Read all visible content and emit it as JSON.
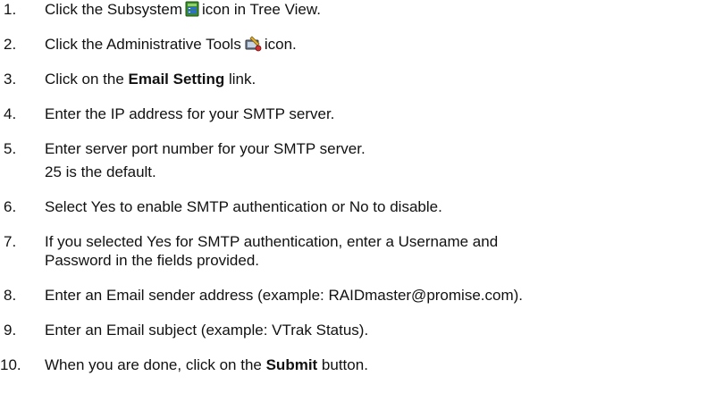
{
  "steps": [
    {
      "num": "1.",
      "pre": "Click the Subsystem",
      "icon": "subsystem-icon",
      "post": "icon in Tree View."
    },
    {
      "num": "2.",
      "pre": "Click the Administrative Tools",
      "icon": "administrative-tools-icon",
      "post": "icon."
    },
    {
      "num": "3.",
      "pre": "Click on the ",
      "bold": "Email Setting",
      "post": " link."
    },
    {
      "num": "4.",
      "text": "Enter the IP address for your SMTP server."
    },
    {
      "num": "5.",
      "text": "Enter server port number for your SMTP server.",
      "note": "25 is the default."
    },
    {
      "num": "6.",
      "text": "Select Yes to enable SMTP authentication or No to disable."
    },
    {
      "num": "7.",
      "text": "If you selected Yes for SMTP authentication, enter a Username and",
      "text2": "Password in the fields provided."
    },
    {
      "num": "8.",
      "text": "Enter an Email sender address (example: RAIDmaster@promise.com)."
    },
    {
      "num": "9.",
      "text": "Enter an Email subject (example: VTrak Status)."
    },
    {
      "num": "10.",
      "pre": "When you are done, click on the ",
      "bold": "Submit",
      "post": " button."
    }
  ]
}
